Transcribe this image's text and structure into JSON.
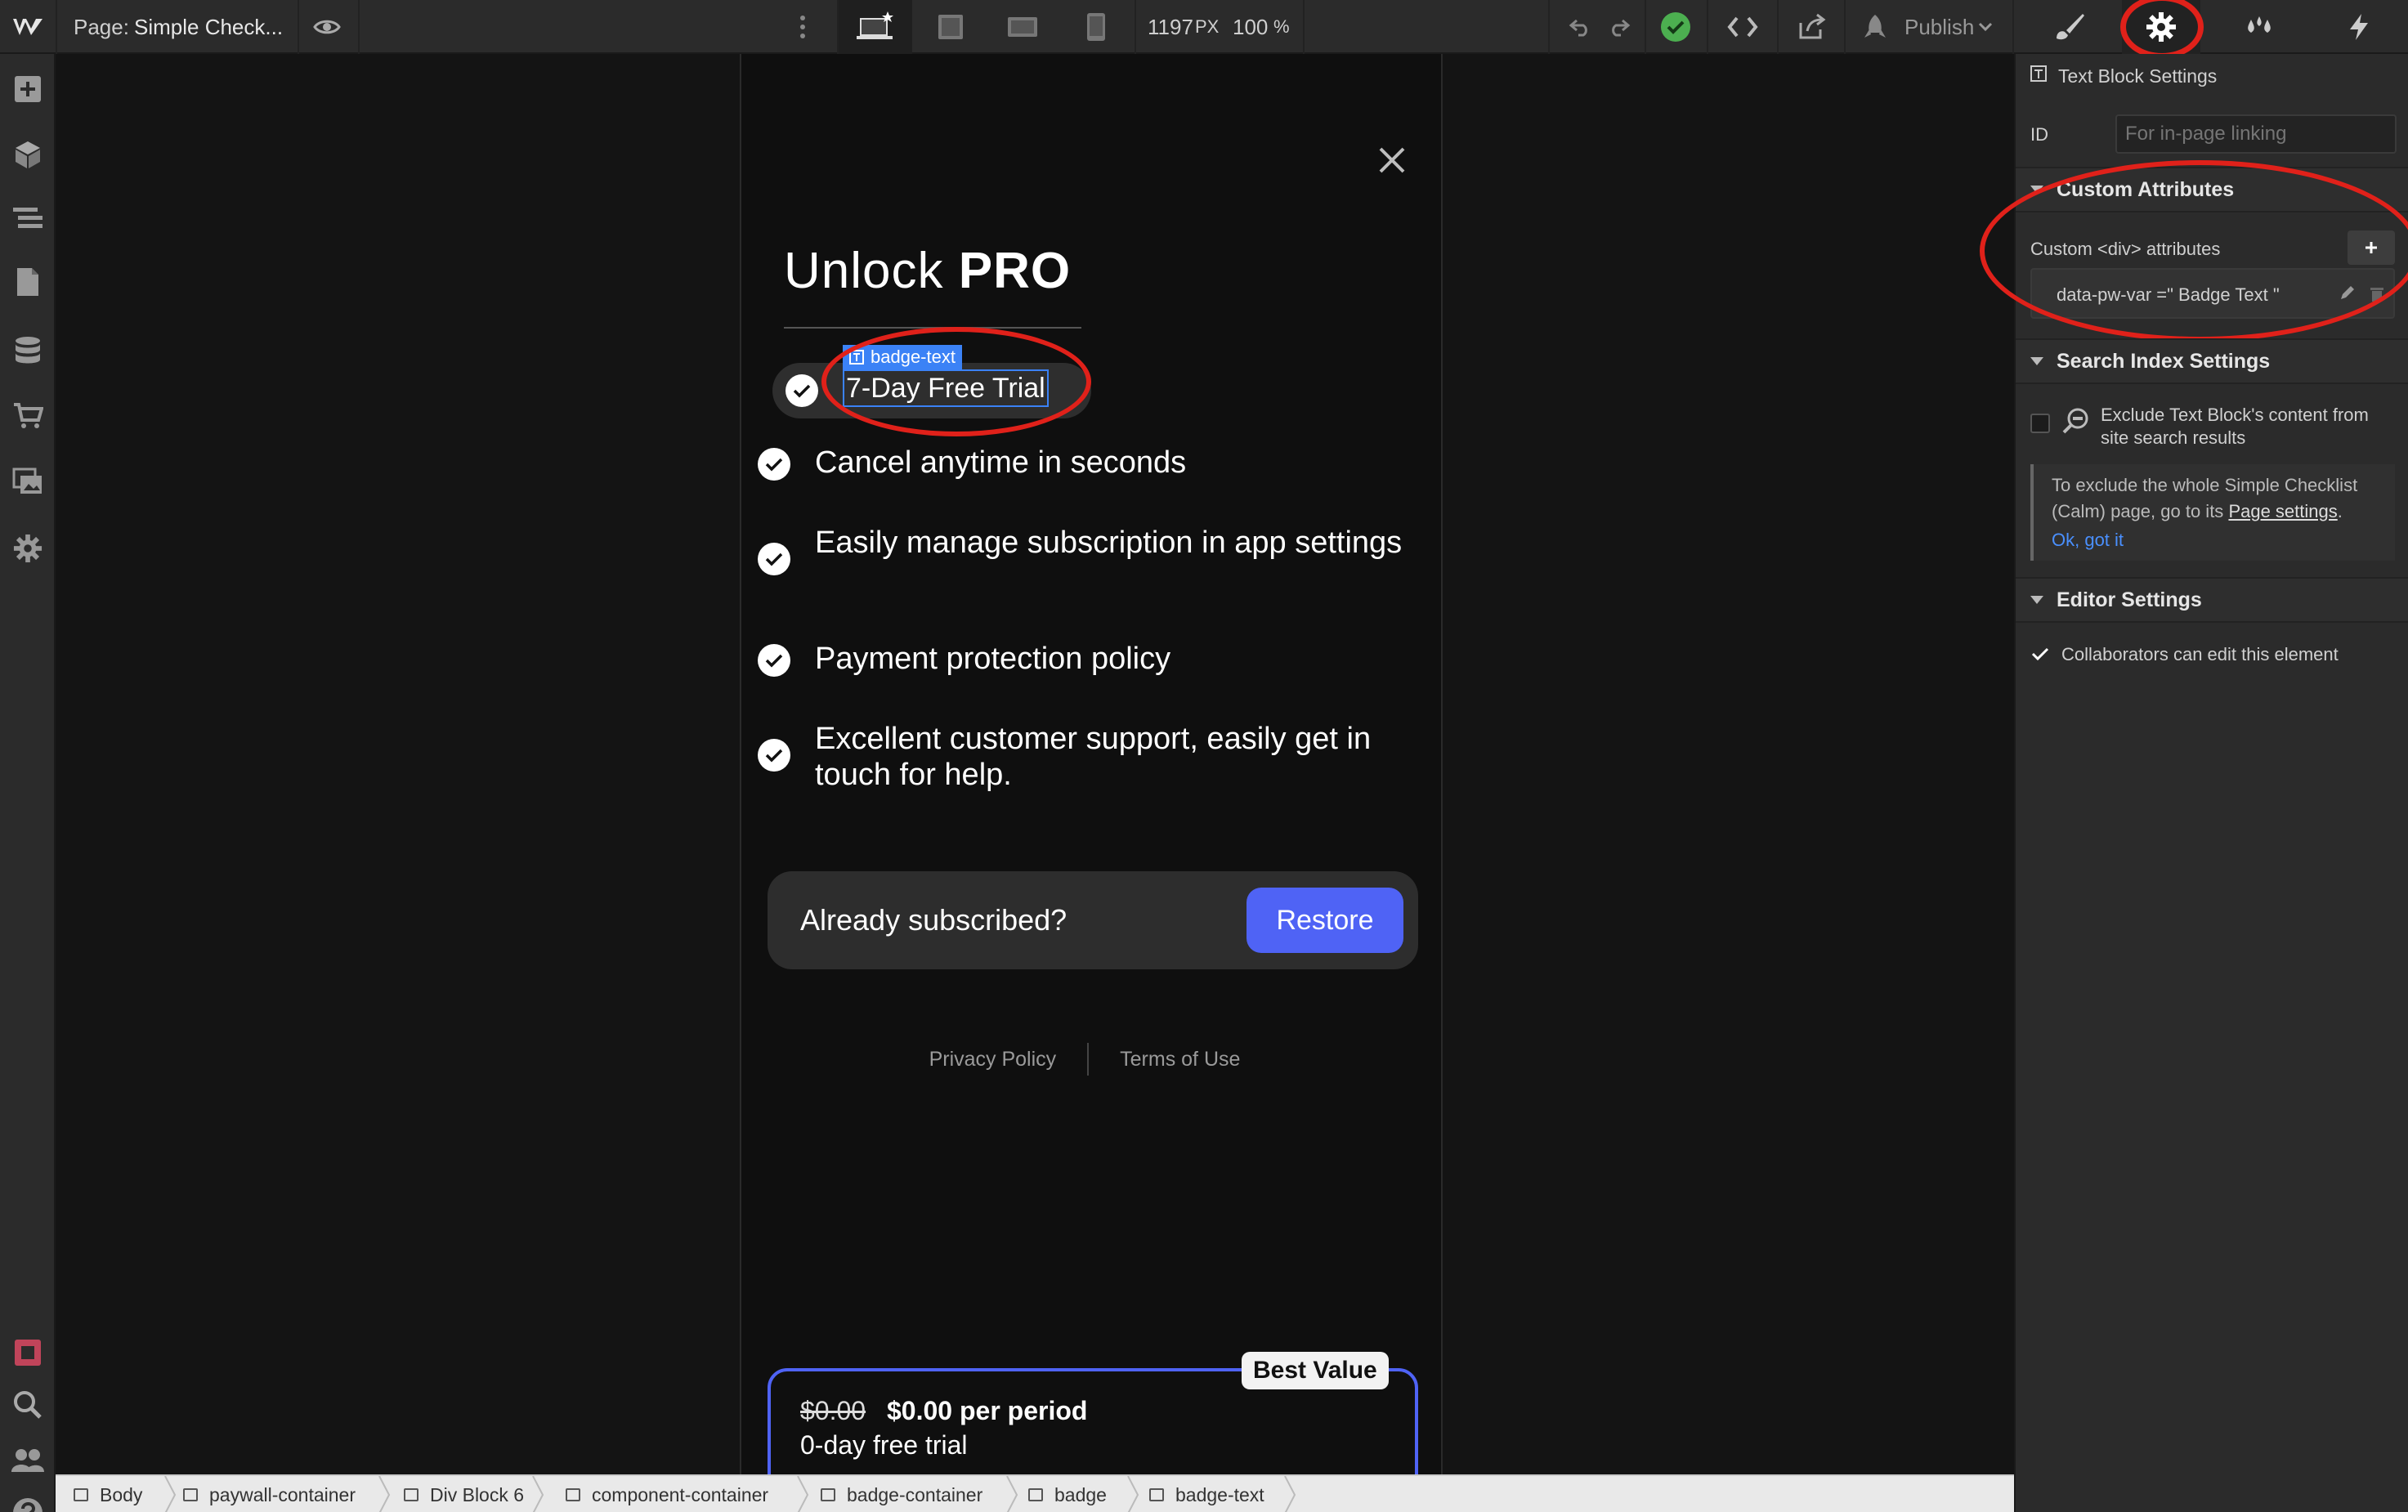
{
  "topbar": {
    "page_label": "Page:",
    "page_name": "Simple Check...",
    "width_value": "1197",
    "width_unit": "PX",
    "zoom_value": "100",
    "zoom_unit": "%",
    "publish_label": "Publish"
  },
  "paywall": {
    "title_light": "Unlock",
    "title_bold": "PRO",
    "badge_tag": "badge-text",
    "badge_text": "7-Day Free Trial",
    "features": [
      "Cancel anytime in seconds",
      "Easily manage subscription in app settings",
      "Payment protection policy",
      "Excellent customer support, easily get in touch for help."
    ],
    "restore_prompt": "Already subscribed?",
    "restore_button": "Restore",
    "privacy_link": "Privacy Policy",
    "terms_link": "Terms of Use",
    "plan": {
      "badge": "Best Value",
      "old_price": "$0.00",
      "price": "$0.00 per period",
      "trial": "0-day free trial"
    }
  },
  "panel": {
    "header": "Text Block Settings",
    "id_label": "ID",
    "id_placeholder": "For in-page linking",
    "custom_attributes_title": "Custom Attributes",
    "custom_div_label": "Custom <div> attributes",
    "attribute_row": "data-pw-var =\" Badge Text \"",
    "search_title": "Search Index Settings",
    "exclude_label": "Exclude Text Block's content from site search results",
    "info_text_1": "To exclude the whole Simple Checklist (Calm) page, go to its",
    "info_link": "Page settings",
    "info_dismiss": "Ok, got it",
    "editor_title": "Editor Settings",
    "collab_label": "Collaborators can edit this element",
    "collab_checked": true
  },
  "breadcrumb": [
    "Body",
    "paywall-container",
    "Div Block 6",
    "component-container",
    "badge-container",
    "badge",
    "badge-text"
  ],
  "colors": {
    "accent_blue": "#4f63f5",
    "selection_blue": "#3b82f6",
    "annotation_red": "#e0211a",
    "ok_green": "#4caf50"
  },
  "icons": [
    "webflow-logo-icon",
    "eye-icon",
    "more-icon",
    "desktop-icon",
    "tablet-icon",
    "tablet-landscape-icon",
    "phone-icon",
    "undo-icon",
    "redo-icon",
    "check-circle-icon",
    "code-icon",
    "export-icon",
    "publish-icon",
    "brush-icon",
    "gear-icon",
    "drops-icon",
    "lightning-icon",
    "add-icon",
    "cube-icon",
    "navigator-icon",
    "pages-icon",
    "cms-icon",
    "ecommerce-icon",
    "assets-icon",
    "settings-icon",
    "stop-icon",
    "search-icon",
    "users-icon",
    "help-icon",
    "close-icon"
  ]
}
